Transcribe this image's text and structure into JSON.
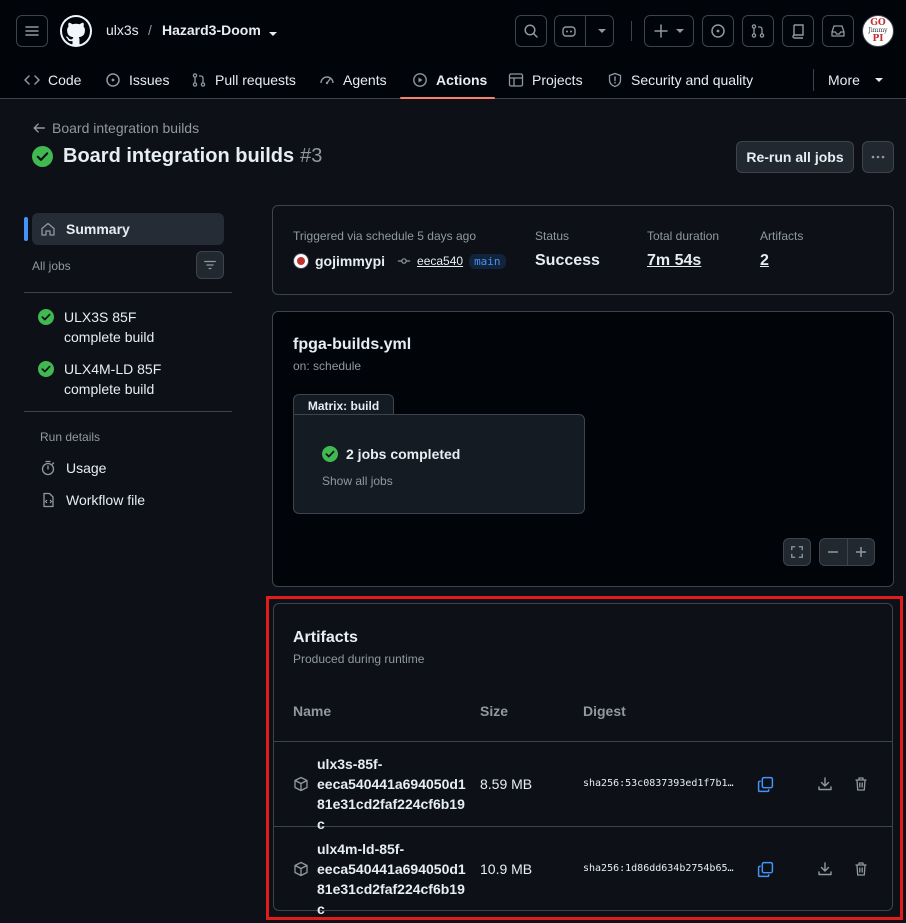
{
  "header": {
    "owner": "ulx3s",
    "separator": "/",
    "repo": "Hazard3-Doom",
    "avatar_text": [
      "GO",
      "Jimmy",
      "PI"
    ]
  },
  "nav": {
    "tabs": [
      {
        "label": "Code",
        "icon": "code-icon"
      },
      {
        "label": "Issues",
        "icon": "issue-icon"
      },
      {
        "label": "Pull requests",
        "icon": "pull-request-icon"
      },
      {
        "label": "Agents",
        "icon": "agent-icon"
      },
      {
        "label": "Actions",
        "icon": "play-icon",
        "active": true
      },
      {
        "label": "Projects",
        "icon": "table-icon"
      },
      {
        "label": "Security and quality",
        "icon": "shield-icon"
      }
    ],
    "more_label": "More"
  },
  "page": {
    "back_label": "Board integration builds",
    "title": "Board integration builds",
    "run_number": "#3",
    "rerun_label": "Re-run all jobs"
  },
  "sidebar": {
    "summary_label": "Summary",
    "all_jobs_label": "All jobs",
    "jobs": [
      {
        "line1": "ULX3S 85F",
        "line2": "complete build"
      },
      {
        "line1": "ULX4M-LD 85F",
        "line2": "complete build"
      }
    ],
    "run_details_label": "Run details",
    "usage_label": "Usage",
    "workflow_file_label": "Workflow file"
  },
  "summary": {
    "triggered_label": "Triggered via schedule 5 days ago",
    "actor": "gojimmypi",
    "commit": "eeca540",
    "branch": "main",
    "status_label": "Status",
    "status_value": "Success",
    "duration_label": "Total duration",
    "duration_value": "7m 54s",
    "artifacts_label": "Artifacts",
    "artifacts_value": "2"
  },
  "workflow": {
    "file": "fpga-builds.yml",
    "trigger": "on: schedule",
    "matrix_label": "Matrix: build",
    "jobs_completed": "2 jobs completed",
    "show_all": "Show all jobs"
  },
  "artifacts": {
    "title": "Artifacts",
    "subtitle": "Produced during runtime",
    "col_name": "Name",
    "col_size": "Size",
    "col_digest": "Digest",
    "rows": [
      {
        "name": [
          "ulx3s-85f-",
          "eeca540441a694050d1",
          "81e31cd2faf224cf6b19c"
        ],
        "size": "8.59 MB",
        "digest": "sha256:53c0837393ed1f7b1…"
      },
      {
        "name": [
          "ulx4m-ld-85f-",
          "eeca540441a694050d1",
          "81e31cd2faf224cf6b19c"
        ],
        "size": "10.9 MB",
        "digest": "sha256:1d86dd634b2754b65…"
      }
    ]
  },
  "colors": {
    "success": "#3fb950",
    "accent": "#4493f8",
    "active_underline": "#f78166",
    "highlight_box": "#e21b1b"
  }
}
